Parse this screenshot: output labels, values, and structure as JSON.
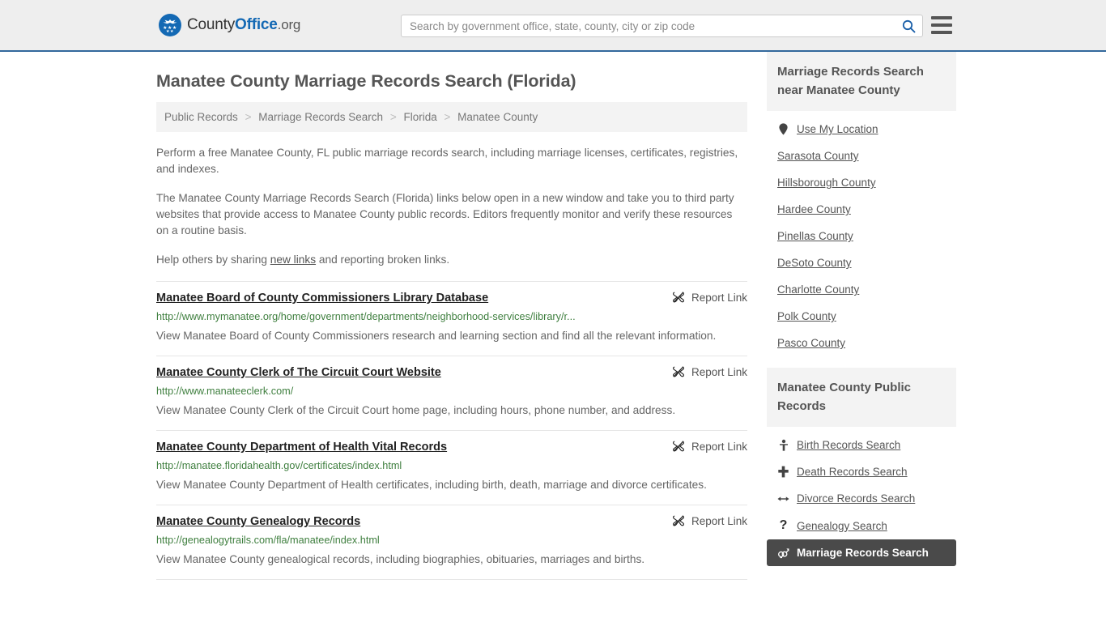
{
  "header": {
    "brand": {
      "part1": "County",
      "part2": "Office",
      "part3": ".org",
      "seal_icon": "eagle-seal-icon"
    },
    "search": {
      "placeholder": "Search by government office, state, county, city or zip code",
      "value": "",
      "button_icon": "search-icon"
    },
    "menu_icon": "hamburger-menu-icon"
  },
  "main": {
    "title": "Manatee County Marriage Records Search (Florida)",
    "breadcrumb": [
      "Public Records",
      "Marriage Records Search",
      "Florida",
      "Manatee County"
    ],
    "breadcrumb_separator": ">",
    "intro": {
      "p1": "Perform a free Manatee County, FL public marriage records search, including marriage licenses, certificates, registries, and indexes.",
      "p2": "The Manatee County Marriage Records Search (Florida) links below open in a new window and take you to third party websites that provide access to Manatee County public records. Editors frequently monitor and verify these resources on a routine basis.",
      "p3_before": "Help others by sharing ",
      "p3_link": "new links",
      "p3_after": " and reporting broken links."
    },
    "report_link_label": "Report Link",
    "report_link_icon": "broken-link-icon",
    "results": [
      {
        "title": "Manatee Board of County Commissioners Library Database",
        "url": "http://www.mymanatee.org/home/government/departments/neighborhood-services/library/r...",
        "description": "View Manatee Board of County Commissioners research and learning section and find all the relevant information."
      },
      {
        "title": "Manatee County Clerk of The Circuit Court Website",
        "url": "http://www.manateeclerk.com/",
        "description": "View Manatee County Clerk of the Circuit Court home page, including hours, phone number, and address."
      },
      {
        "title": "Manatee County Department of Health Vital Records",
        "url": "http://manatee.floridahealth.gov/certificates/index.html",
        "description": "View Manatee County Department of Health certificates, including birth, death, marriage and divorce certificates."
      },
      {
        "title": "Manatee County Genealogy Records",
        "url": "http://genealogytrails.com/fla/manatee/index.html",
        "description": "View Manatee County genealogical records, including biographies, obituaries, marriages and births."
      }
    ]
  },
  "sidebar": {
    "nearby": {
      "heading": "Marriage Records Search near Manatee County",
      "items": [
        {
          "label": "Use My Location",
          "icon": "map-pin-icon"
        },
        {
          "label": "Sarasota County",
          "icon": ""
        },
        {
          "label": "Hillsborough County",
          "icon": ""
        },
        {
          "label": "Hardee County",
          "icon": ""
        },
        {
          "label": "Pinellas County",
          "icon": ""
        },
        {
          "label": "DeSoto County",
          "icon": ""
        },
        {
          "label": "Charlotte County",
          "icon": ""
        },
        {
          "label": "Polk County",
          "icon": ""
        },
        {
          "label": "Pasco County",
          "icon": ""
        }
      ]
    },
    "public_records": {
      "heading": "Manatee County Public Records",
      "items": [
        {
          "label": "Birth Records Search",
          "icon": "baby-icon",
          "active": false
        },
        {
          "label": "Death Records Search",
          "icon": "cross-icon",
          "active": false
        },
        {
          "label": "Divorce Records Search",
          "icon": "left-right-arrow-icon",
          "active": false
        },
        {
          "label": "Genealogy Search",
          "icon": "question-mark-icon",
          "active": false
        },
        {
          "label": "Marriage Records Search",
          "icon": "gender-symbols-icon",
          "active": true
        }
      ]
    }
  },
  "colors": {
    "header_bg": "#eeeeee",
    "header_border": "#33699c",
    "brand_blue": "#1469b4",
    "url_green": "#3f7f3f",
    "panel_bg": "#f3f3f3",
    "active_bg": "#4a4a4a"
  }
}
